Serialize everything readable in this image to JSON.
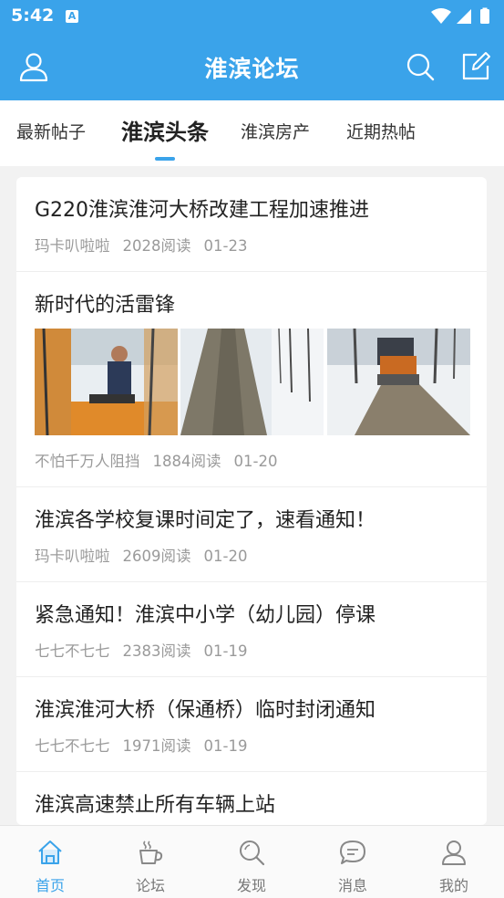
{
  "status_bar": {
    "time": "5:42",
    "notification_badge": "A"
  },
  "app_bar": {
    "title": "淮滨论坛",
    "left_icon": "user-icon",
    "right_icons": [
      "search-icon",
      "edit-icon"
    ]
  },
  "tabs": [
    {
      "label": "最新帖子",
      "active": false
    },
    {
      "label": "淮滨头条",
      "active": true
    },
    {
      "label": "淮滨房产",
      "active": false
    },
    {
      "label": "近期热帖",
      "active": false
    }
  ],
  "posts": [
    {
      "title": "G220淮滨淮河大桥改建工程加速推进",
      "author": "玛卡叭啦啦",
      "reads": "2028阅读",
      "date": "01-23",
      "images": []
    },
    {
      "title": "新时代的活雷锋",
      "author": "不怕千万人阻挡",
      "reads": "1884阅读",
      "date": "01-20",
      "images": [
        "loader-driver-photo",
        "snowy-road-photo",
        "snow-plow-photo"
      ]
    },
    {
      "title": "淮滨各学校复课时间定了，速看通知！",
      "author": "玛卡叭啦啦",
      "reads": "2609阅读",
      "date": "01-20",
      "images": []
    },
    {
      "title": "紧急通知！淮滨中小学（幼儿园）停课",
      "author": "七七不七七",
      "reads": "2383阅读",
      "date": "01-19",
      "images": []
    },
    {
      "title": "淮滨淮河大桥（保通桥）临时封闭通知",
      "author": "七七不七七",
      "reads": "1971阅读",
      "date": "01-19",
      "images": []
    },
    {
      "title": "淮滨高速禁止所有车辆上站",
      "author": "",
      "reads": "",
      "date": "",
      "images": []
    }
  ],
  "bottom_nav": [
    {
      "label": "首页",
      "icon": "home-icon",
      "active": true
    },
    {
      "label": "论坛",
      "icon": "coffee-icon",
      "active": false
    },
    {
      "label": "发现",
      "icon": "discover-icon",
      "active": false
    },
    {
      "label": "消息",
      "icon": "message-icon",
      "active": false
    },
    {
      "label": "我的",
      "icon": "profile-icon",
      "active": false
    }
  ],
  "colors": {
    "primary": "#3aa3ea",
    "text": "#222222",
    "meta": "#9a9a9a",
    "background": "#f2f2f2"
  }
}
